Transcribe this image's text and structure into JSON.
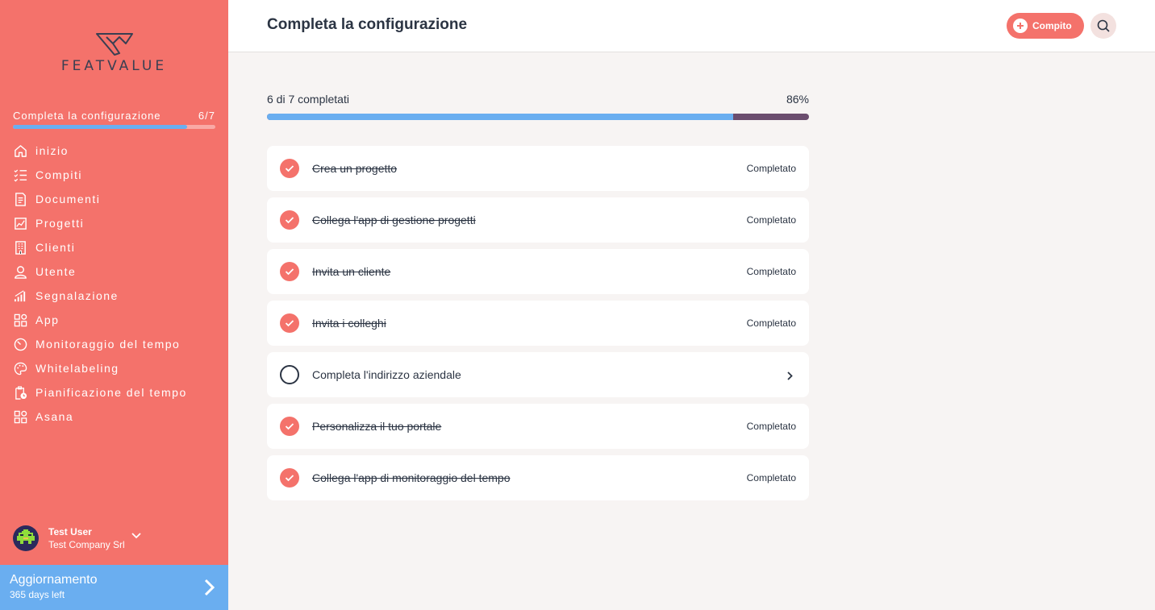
{
  "brand": {
    "name": "FEATVALUE"
  },
  "colors": {
    "accent": "#f4726b",
    "blue": "#6aaef0",
    "dark": "#2b3443",
    "track": "#6b4d6e"
  },
  "sidebar": {
    "setup_label": "Completa la configurazione",
    "setup_count": "6/7",
    "setup_progress": 0.86,
    "nav": [
      {
        "label": "inizio",
        "icon": "home-icon"
      },
      {
        "label": "Compiti",
        "icon": "checklist-icon"
      },
      {
        "label": "Documenti",
        "icon": "document-icon"
      },
      {
        "label": "Progetti",
        "icon": "chart-icon"
      },
      {
        "label": "Clienti",
        "icon": "building-icon"
      },
      {
        "label": "Utente",
        "icon": "user-icon"
      },
      {
        "label": "Segnalazione",
        "icon": "bar-signal-icon"
      },
      {
        "label": "App",
        "icon": "apps-icon"
      },
      {
        "label": "Monitoraggio del tempo",
        "icon": "timer-icon"
      },
      {
        "label": "Whitelabeling",
        "icon": "palette-icon"
      },
      {
        "label": "Pianificazione del tempo",
        "icon": "clipboard-clock-icon"
      },
      {
        "label": "Asana",
        "icon": "apps-icon"
      }
    ],
    "user": {
      "name": "Test User",
      "company": "Test Company Srl"
    },
    "upgrade": {
      "title": "Aggiornamento",
      "subtitle": "365 days left"
    }
  },
  "header": {
    "title": "Completa la configurazione",
    "task_button": "Compito"
  },
  "main": {
    "progress_label": "6 di 7 completati",
    "progress_percent": "86%",
    "progress_value": 0.86,
    "tasks": [
      {
        "label": "Crea un progetto",
        "done": true,
        "status": "Completato"
      },
      {
        "label": "Collega l'app di gestione progetti",
        "done": true,
        "status": "Completato"
      },
      {
        "label": "Invita un cliente",
        "done": true,
        "status": "Completato"
      },
      {
        "label": "Invita i colleghi",
        "done": true,
        "status": "Completato"
      },
      {
        "label": "Completa l'indirizzo aziendale",
        "done": false,
        "status": ""
      },
      {
        "label": "Personalizza il tuo portale",
        "done": true,
        "status": "Completato"
      },
      {
        "label": "Collega l'app di monitoraggio del tempo",
        "done": true,
        "status": "Completato"
      }
    ]
  }
}
